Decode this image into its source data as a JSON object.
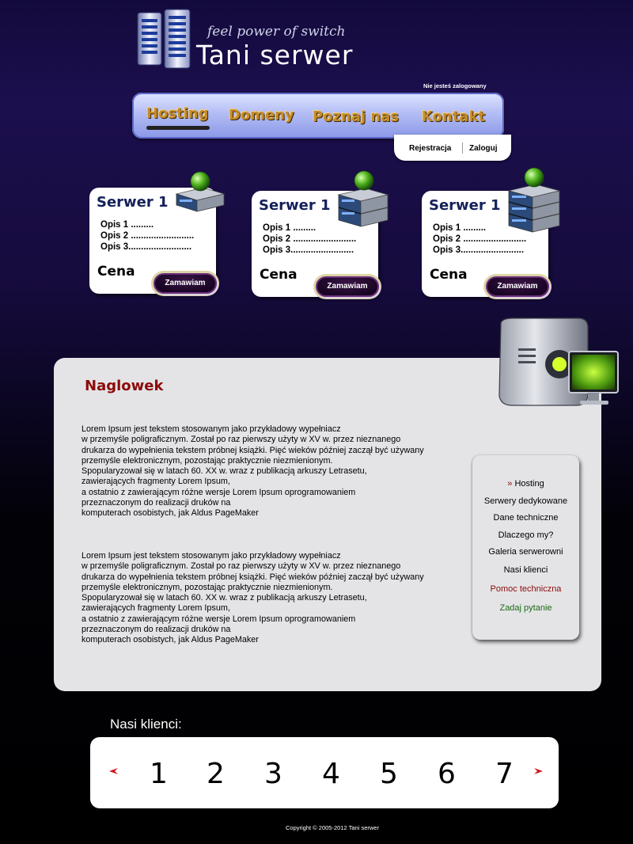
{
  "logo": {
    "tagline": "feel power of switch",
    "title": "Tani serwer"
  },
  "login_status": "Nie jesteś zalogowany",
  "nav": {
    "items": [
      {
        "label": "Hosting",
        "active": true
      },
      {
        "label": "Domeny"
      },
      {
        "label": "Poznaj nas"
      },
      {
        "label": "Kontakt"
      }
    ]
  },
  "account": {
    "register": "Rejestracja",
    "login": "Zaloguj"
  },
  "cards": [
    {
      "title": "Serwer 1",
      "desc1": "Opis 1 .........",
      "desc2": "Opis 2 .........................",
      "desc3": "Opis 3.........................",
      "price": "Cena",
      "order": "Zamawiam",
      "units": 1
    },
    {
      "title": "Serwer 1",
      "desc1": "Opis 1 .........",
      "desc2": "Opis 2 .........................",
      "desc3": "Opis 3.........................",
      "price": "Cena",
      "order": "Zamawiam",
      "units": 2
    },
    {
      "title": "Serwer 1",
      "desc1": "Opis 1 .........",
      "desc2": "Opis 2 .........................",
      "desc3": "Opis 3.........................",
      "price": "Cena",
      "order": "Zamawiam",
      "units": 3
    }
  ],
  "main": {
    "heading": "Naglowek",
    "para1": "Lorem Ipsum jest tekstem stosowanym jako przykładowy wypełniacz\nw przemyśle poligraficznym. Został po raz pierwszy użyty w XV w. przez nieznanego\ndrukarza do wypełnienia tekstem próbnej książki. Pięć wieków później zaczął być używany\nprzemyśle elektronicznym, pozostając praktycznie niezmienionym.\nSpopularyzował się w latach 60. XX w. wraz z publikacją arkuszy Letrasetu,\nzawierających fragmenty Lorem Ipsum,\n a ostatnio z zawierającym różne wersje Lorem Ipsum oprogramowaniem\nprzeznaczonym do realizacji druków na\n komputerach osobistych, jak Aldus PageMaker",
    "para2": "Lorem Ipsum jest tekstem stosowanym jako przykładowy wypełniacz\nw przemyśle poligraficznym. Został po raz pierwszy użyty w XV w. przez nieznanego\ndrukarza do wypełnienia tekstem próbnej książki. Pięć wieków później zaczął być używany\nprzemyśle elektronicznym, pozostając praktycznie niezmienionym.\nSpopularyzował się w latach 60. XX w. wraz z publikacją arkuszy Letrasetu,\nzawierających fragmenty Lorem Ipsum,\n a ostatnio z zawierającym różne wersje Lorem Ipsum oprogramowaniem\nprzeznaczonym do realizacji druków na\n komputerach osobistych, jak Aldus PageMaker"
  },
  "side_menu": {
    "active_marker": "»",
    "items": [
      {
        "label": "Hosting",
        "color": "#000000"
      },
      {
        "label": "Serwery dedykowane",
        "color": "#000000"
      },
      {
        "label": "Dane techniczne",
        "color": "#000000"
      },
      {
        "label": "Dlaczego my?",
        "color": "#000000"
      },
      {
        "label": "Galeria serwerowni",
        "color": "#000000"
      },
      {
        "label": "Nasi klienci",
        "color": "#000000"
      },
      {
        "label": "Pomoc techniczna",
        "color": "#8b0b0b"
      },
      {
        "label": "Zadaj pytanie",
        "color": "#1d6b12"
      }
    ]
  },
  "clients": {
    "heading": "Nasi klienci:",
    "numbers": [
      "1",
      "2",
      "3",
      "4",
      "5",
      "6",
      "7"
    ]
  },
  "copyright": "Copyright © 2005-2012 Tani serwer",
  "colors": {
    "nav_text": "#c58b2a",
    "heading_red": "#8b0b0b",
    "card_title": "#14205a",
    "arrow_red": "#d1141d"
  },
  "icons": {
    "logo": "server-tower-icon",
    "card": "server-rack-icon",
    "globe": "green-globe-icon",
    "pc": "computer-monitor-icon",
    "prev": "chevron-left-icon",
    "next": "chevron-right-icon"
  }
}
